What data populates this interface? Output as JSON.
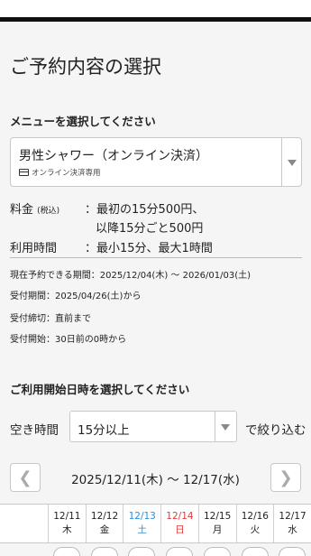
{
  "page": {
    "title": "ご予約内容の選択"
  },
  "menu_section": {
    "heading": "メニューを選択してください",
    "selected_name": "男性シャワー（オンライン決済）",
    "selected_sub": "オンライン決済専用"
  },
  "pricing": {
    "fee_label": "料金",
    "fee_tax": "(税込)",
    "fee_line1": "：最初の15分500円、",
    "fee_line2": "以降15分ごと500円",
    "time_label": "利用時間",
    "time_value": "：最小15分、最大1時間"
  },
  "info": {
    "period": "現在予約できる期間：2025/12/04(木) 〜 2026/01/03(土)",
    "accept_period": "受付期間：2025/04/26(土)から",
    "deadline": "受付締切：直前まで",
    "start": "受付開始：30日前の0時から"
  },
  "datetime_section": {
    "heading": "ご利用開始日時を選択してください",
    "filter_label": "空き時間",
    "filter_value": "15分以上",
    "filter_suffix": "で絞り込む"
  },
  "calendar": {
    "prev_icon": "chevron-left-icon",
    "next_icon": "chevron-right-icon",
    "range": "2025/12/11(木) 〜 12/17(水)",
    "days": [
      {
        "date": "12/11",
        "weekday": "木",
        "color": "#222222"
      },
      {
        "date": "12/12",
        "weekday": "金",
        "color": "#222222"
      },
      {
        "date": "12/13",
        "weekday": "土",
        "color": "#2a8ed8"
      },
      {
        "date": "12/14",
        "weekday": "日",
        "color": "#e03b3b"
      },
      {
        "date": "12/15",
        "weekday": "月",
        "color": "#222222"
      },
      {
        "date": "12/16",
        "weekday": "火",
        "color": "#222222"
      },
      {
        "date": "12/17",
        "weekday": "水",
        "color": "#222222"
      }
    ]
  }
}
